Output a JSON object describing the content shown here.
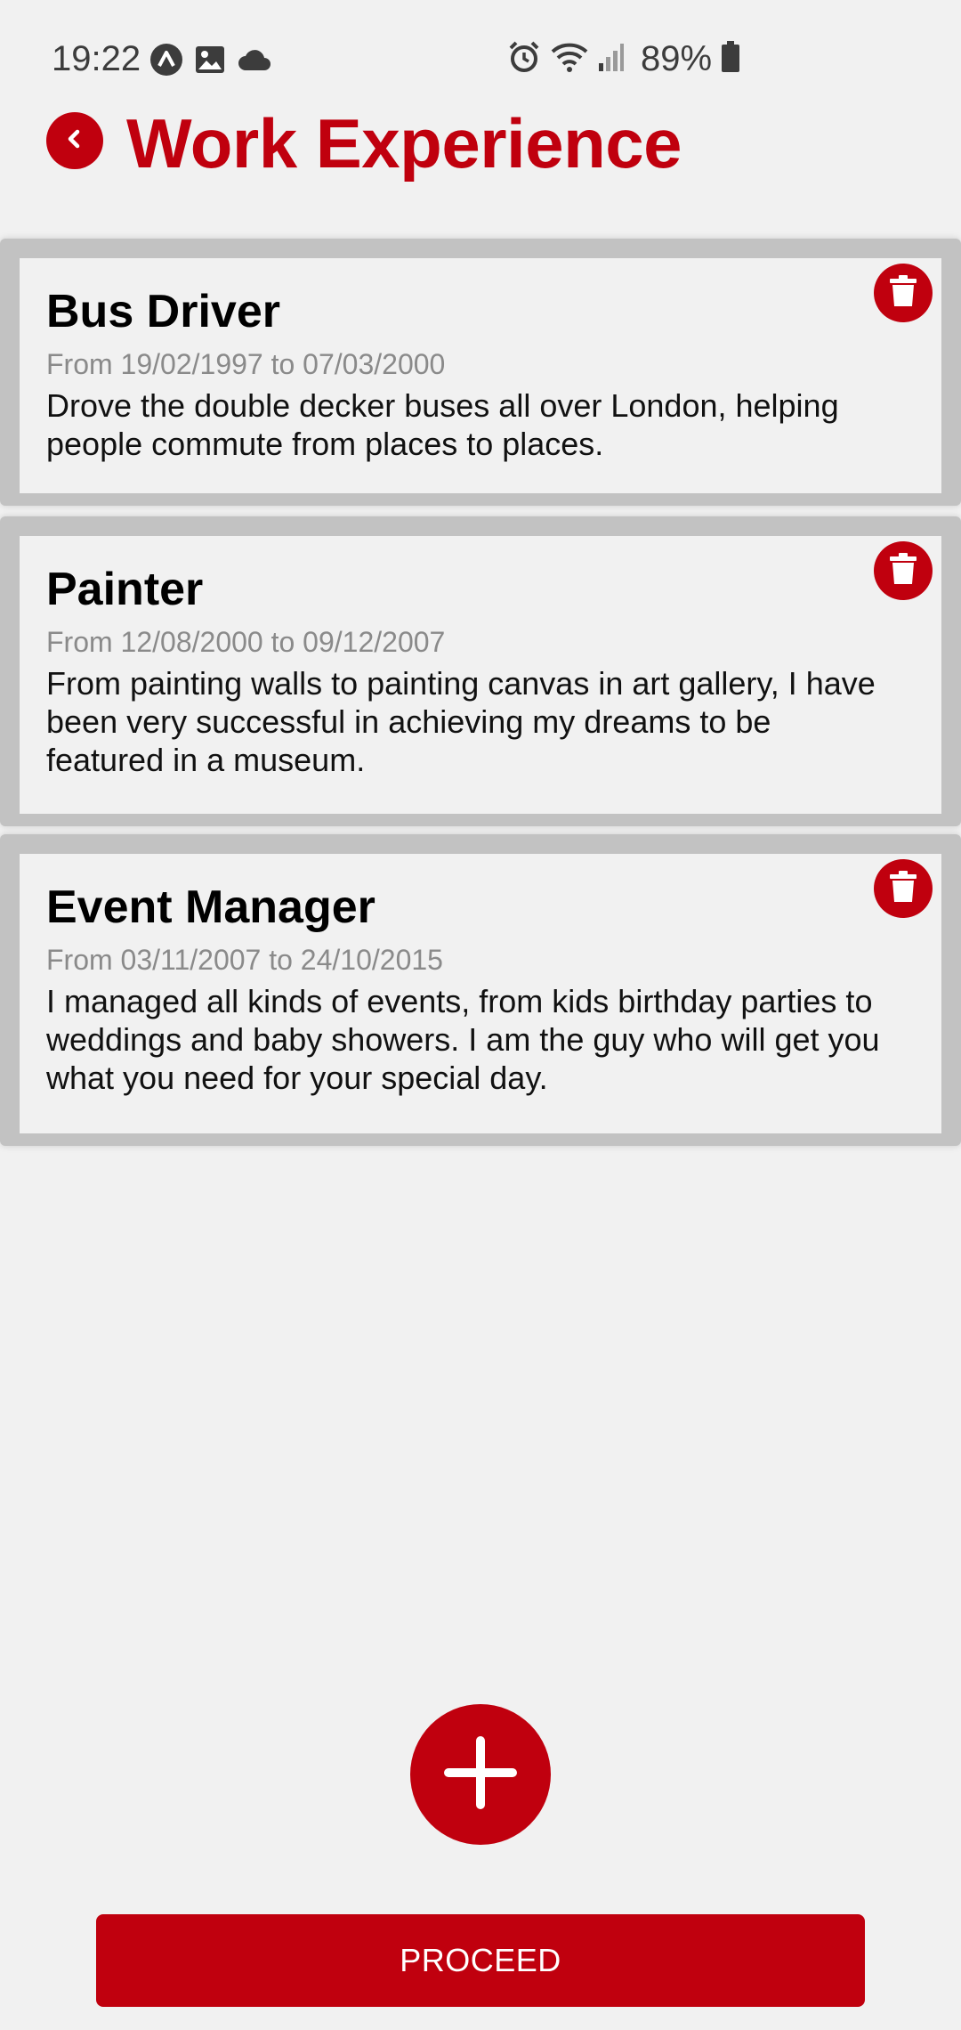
{
  "status_bar": {
    "time": "19:22",
    "battery": "89%",
    "left_icons": [
      "navigation-icon",
      "gallery-icon",
      "cloud-icon"
    ],
    "right_icons": [
      "alarm-icon",
      "wifi-icon",
      "signal-icon",
      "battery-icon"
    ]
  },
  "header": {
    "title": "Work Experience",
    "back_icon": "chevron-left-icon"
  },
  "experiences": [
    {
      "title": "Bus Driver",
      "dates": "From 19/02/1997 to 07/03/2000",
      "description": "Drove the double decker buses all over  London, helping people commute from places to places."
    },
    {
      "title": "Painter",
      "dates": "From 12/08/2000 to 09/12/2007",
      "description": "From painting walls to painting canvas in art gallery, I have been very successful in achieving my dreams to be featured in a museum."
    },
    {
      "title": "Event Manager",
      "dates": "From 03/11/2007 to 24/10/2015",
      "description": "I managed all kinds of events, from kids birthday parties to weddings and baby showers. I am the guy who will get you what you need for your special day."
    }
  ],
  "actions": {
    "add_icon": "plus-icon",
    "proceed_label": "PROCEED"
  },
  "colors": {
    "accent": "#c0000e",
    "background": "#f1f1f1",
    "card_border": "#c2c2c2",
    "date_text": "#8a8a8a"
  }
}
